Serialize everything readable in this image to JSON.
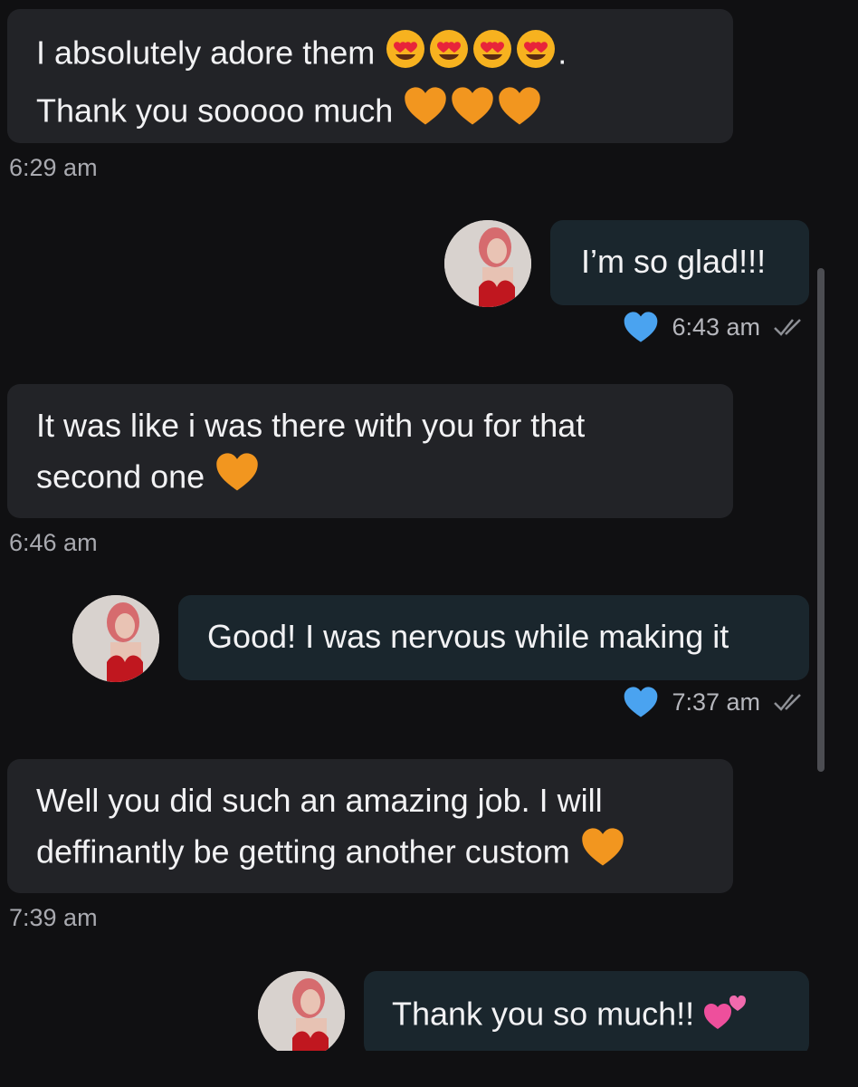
{
  "messages": [
    {
      "direction": "in",
      "lines": [
        "I absolutely adore them",
        "Thank you sooooo much"
      ],
      "time": "6:29 am",
      "emojis_line1": [
        "heart-eyes",
        "heart-eyes",
        "heart-eyes",
        "heart-eyes"
      ],
      "line1_suffix": ".",
      "emojis_line2": [
        "orange-heart",
        "orange-heart",
        "orange-heart"
      ]
    },
    {
      "direction": "out",
      "text": "I’m so glad!!!",
      "time": "6:43 am",
      "liked": true,
      "read": true
    },
    {
      "direction": "in",
      "lines": [
        "It was like i was there with you for that",
        "second one"
      ],
      "time": "6:46 am",
      "emojis_line2": [
        "orange-heart"
      ]
    },
    {
      "direction": "out",
      "text": "Good! I was nervous while making it",
      "time": "7:37 am",
      "liked": true,
      "read": true
    },
    {
      "direction": "in",
      "lines": [
        "Well you did such an amazing job. I will",
        "deffinantly be getting another custom"
      ],
      "time": "7:39 am",
      "emojis_line2": [
        "orange-heart"
      ]
    },
    {
      "direction": "out",
      "text": "Thank you so much!!",
      "time": "",
      "emojis": [
        "two-hearts"
      ]
    }
  ],
  "colors": {
    "background": "#101012",
    "incoming_bubble": "#222327",
    "outgoing_bubble": "#1a262d",
    "like_heart": "#4aa3f0",
    "orange_heart": "#f2961f",
    "pink_heart": "#ee4f9c"
  }
}
